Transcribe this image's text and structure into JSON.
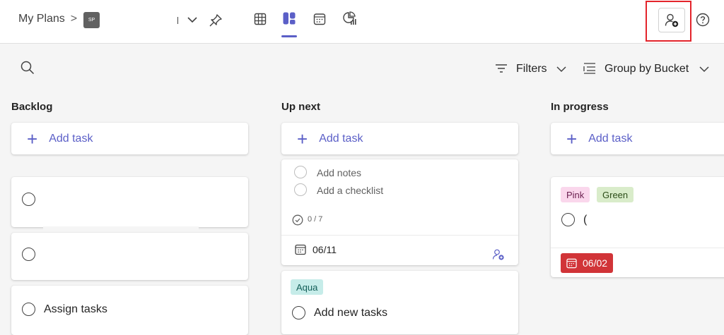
{
  "breadcrumb": {
    "root": "My Plans",
    "separator": ">",
    "plan_initials": "SP"
  },
  "toolbar": {
    "filters_label": "Filters",
    "group_label": "Group by Bucket"
  },
  "buckets": [
    {
      "title": "Backlog",
      "add_label": "Add task",
      "tasks": [
        "",
        "",
        "Assign tasks"
      ]
    },
    {
      "title": "Up next",
      "add_label": "Add task",
      "expanded_card": {
        "notes": "Add notes",
        "checklist": "Add a checklist",
        "progress": "0 / 7",
        "due": "06/11"
      },
      "next_card": {
        "label": "Aqua",
        "title": "Add new tasks"
      }
    },
    {
      "title": "In progress",
      "add_label": "Add task",
      "card": {
        "labels": [
          "Pink",
          "Green"
        ],
        "title": "(",
        "due": "06/02"
      }
    }
  ],
  "colors": {
    "accent": "#5b5fc7",
    "highlight": "#e3242b",
    "pink_bg": "#fad7ec",
    "pink_fg": "#6b1f4f",
    "green_bg": "#d9ecca",
    "green_fg": "#2c4d18",
    "aqua_bg": "#c6ece9",
    "aqua_fg": "#125e58",
    "overdue": "#d13438"
  }
}
